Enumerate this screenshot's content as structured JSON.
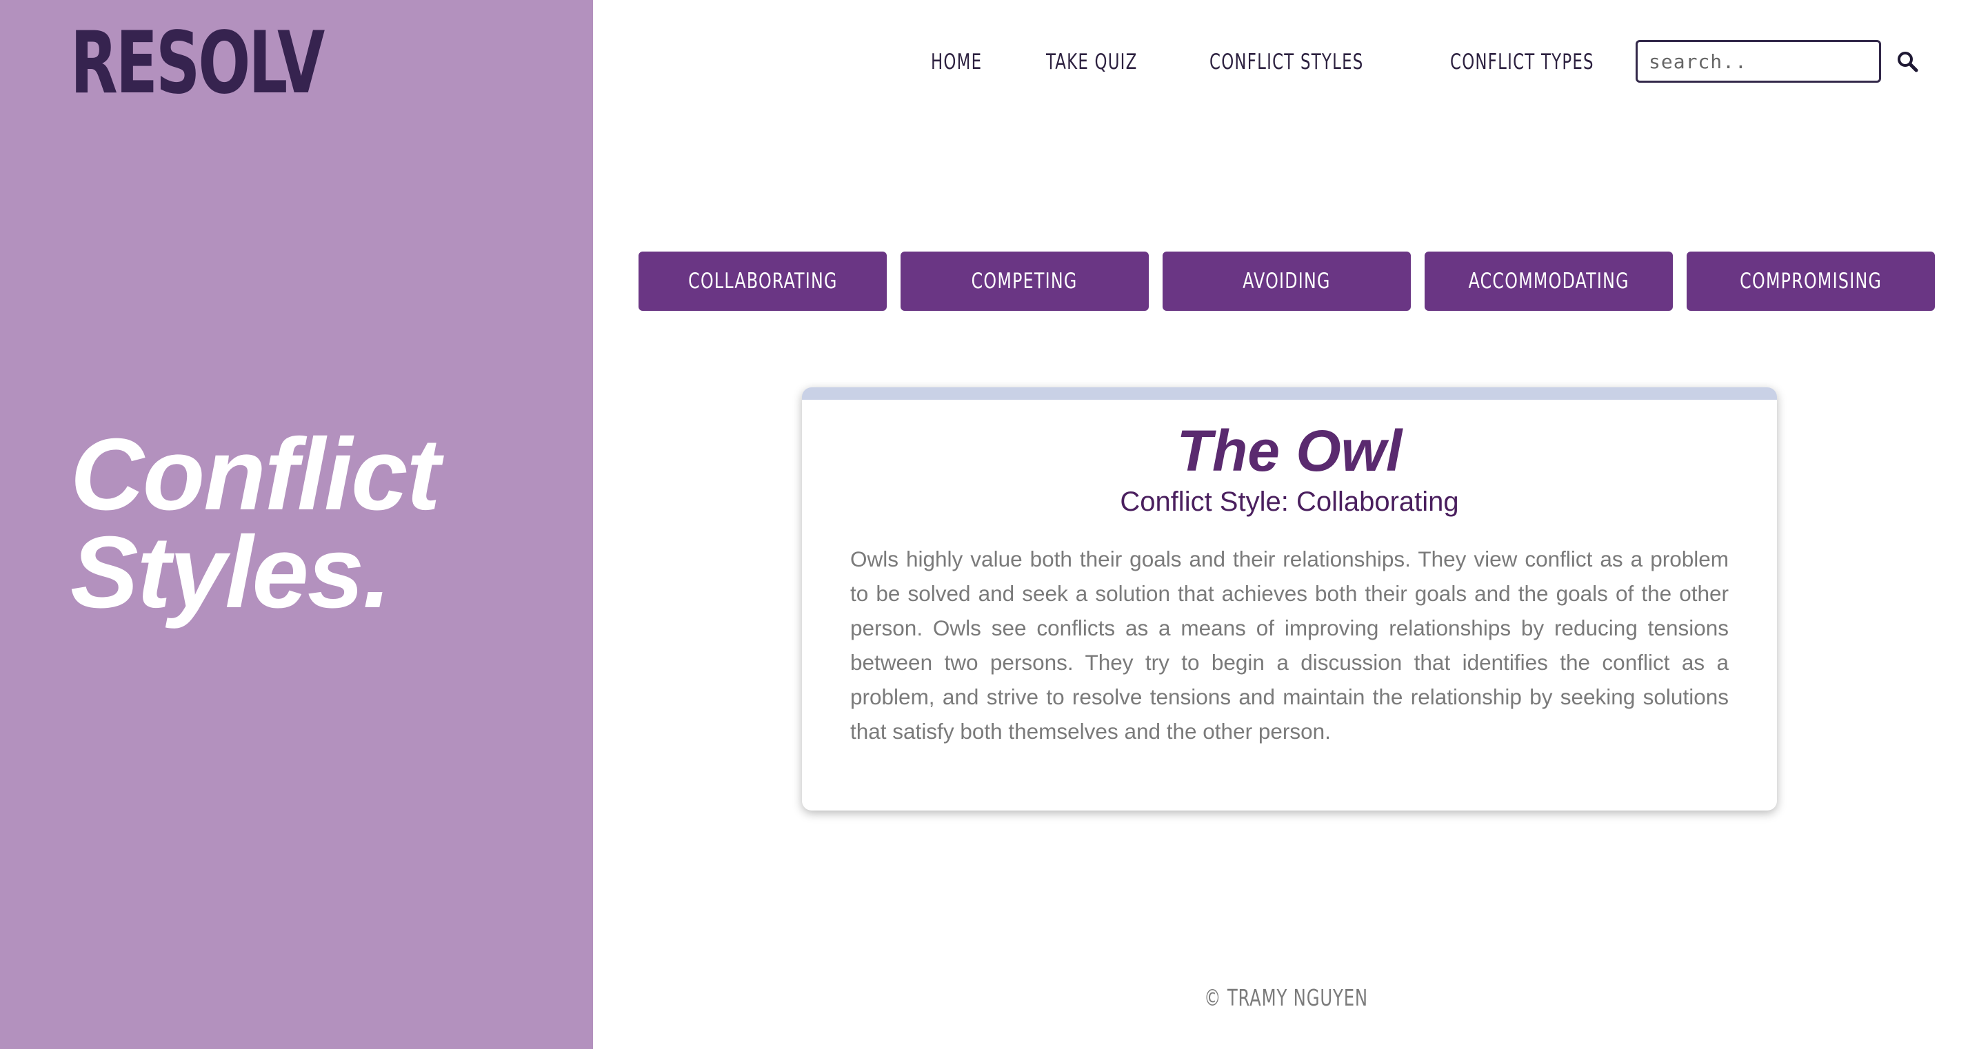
{
  "brand": {
    "logo_text": "RESOLV",
    "colors": {
      "sidebar_bg": "#b391be",
      "logo": "#36234f",
      "button_bg": "#6a3684",
      "card_accent": "#c9d1e6",
      "title": "#5a2a6f"
    }
  },
  "hero": {
    "line1": "Conflict",
    "line2": "Styles."
  },
  "nav": {
    "items": [
      {
        "label": "HOME"
      },
      {
        "label": "TAKE QUIZ"
      },
      {
        "label": "CONFLICT STYLES"
      },
      {
        "label": "CONFLICT TYPES"
      }
    ],
    "search": {
      "placeholder": "search..",
      "value": "",
      "icon": "search-icon"
    }
  },
  "style_tabs": [
    {
      "label": "COLLABORATING"
    },
    {
      "label": "COMPETING"
    },
    {
      "label": "AVOIDING"
    },
    {
      "label": "ACCOMMODATING"
    },
    {
      "label": "COMPROMISING"
    }
  ],
  "card": {
    "title": "The Owl",
    "subtitle": "Conflict Style: Collaborating",
    "body": "Owls highly value both their goals and their relationships. They view conflict as a problem to be solved and seek a solution that achieves both their goals and the goals of the other person. Owls see conflicts as a means of improving relationships by reducing tensions between two persons. They try to begin a discussion that identifies the conflict as a problem, and strive to resolve tensions and maintain the relationship by seeking solutions that satisfy both themselves and the other person."
  },
  "footer": {
    "text": "© TRAMY NGUYEN"
  }
}
